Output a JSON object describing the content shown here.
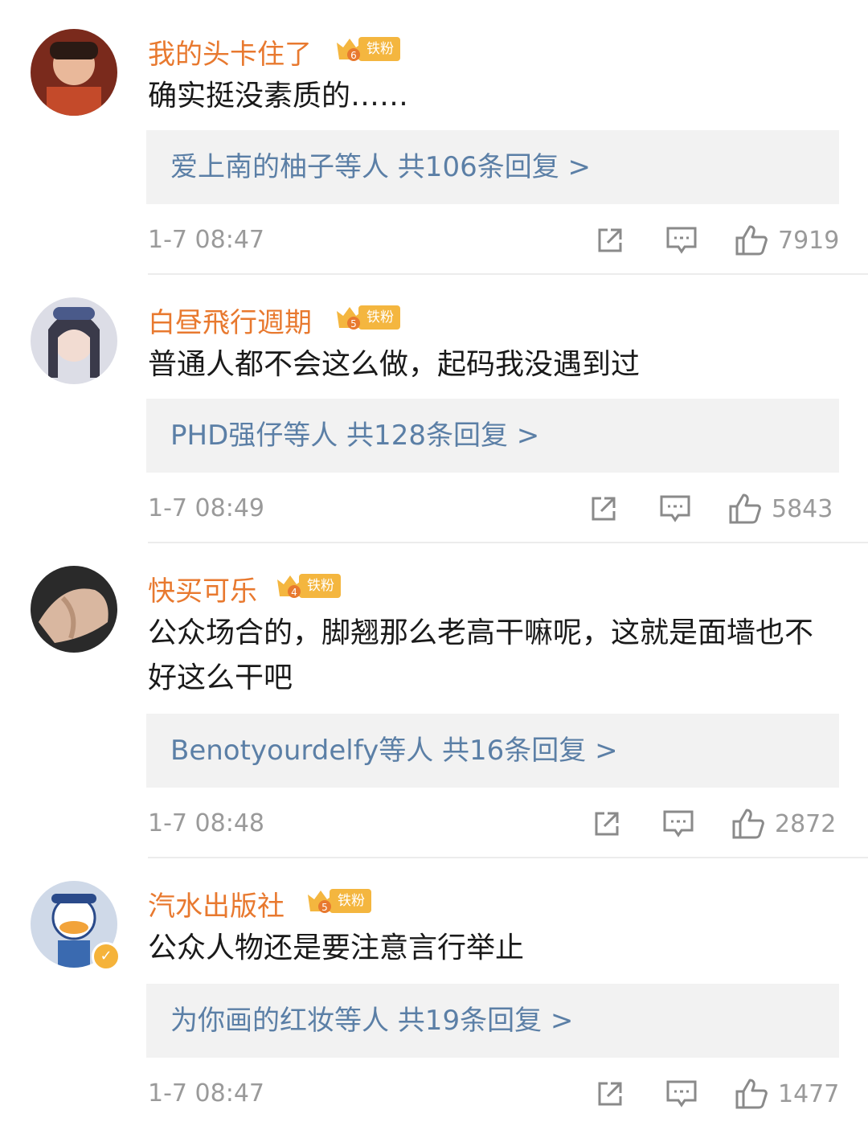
{
  "colors": {
    "username": "#e8792f",
    "reply_link": "#5b7fa6",
    "badge": "#f4b63f",
    "meta": "#9a9a9a"
  },
  "comments": [
    {
      "username": "我的头卡住了",
      "fan_level": "6",
      "fan_badge": "铁粉",
      "text": "确实挺没素质的……",
      "reply_summary": "爱上南的柚子等人  共106条回复 >",
      "time": "1-7 08:47",
      "likes": "7919",
      "actions": [
        "share-icon",
        "comment-icon",
        "like-icon"
      ]
    },
    {
      "username": "白昼飛行週期",
      "fan_level": "5",
      "fan_badge": "铁粉",
      "text": "普通人都不会这么做，起码我没遇到过",
      "reply_summary": "PHD强仔等人  共128条回复 >",
      "time": "1-7 08:49",
      "likes": "5843",
      "actions": [
        "share-icon",
        "comment-icon",
        "like-icon"
      ]
    },
    {
      "username": "快买可乐",
      "fan_level": "4",
      "fan_badge": "铁粉",
      "text": "公众场合的，脚翘那么老高干嘛呢，这就是面墙也不好这么干吧",
      "reply_summary": "Benotyourdelfy等人  共16条回复 >",
      "time": "1-7 08:48",
      "likes": "2872",
      "actions": [
        "share-icon",
        "comment-icon",
        "like-icon"
      ]
    },
    {
      "username": "汽水出版社",
      "fan_level": "5",
      "fan_badge": "铁粉",
      "text": "公众人物还是要注意言行举止",
      "reply_summary": "为你画的红妆等人  共19条回复 >",
      "time": "1-7 08:47",
      "likes": "1477",
      "actions": [
        "share-icon",
        "comment-icon",
        "like-icon"
      ]
    }
  ]
}
